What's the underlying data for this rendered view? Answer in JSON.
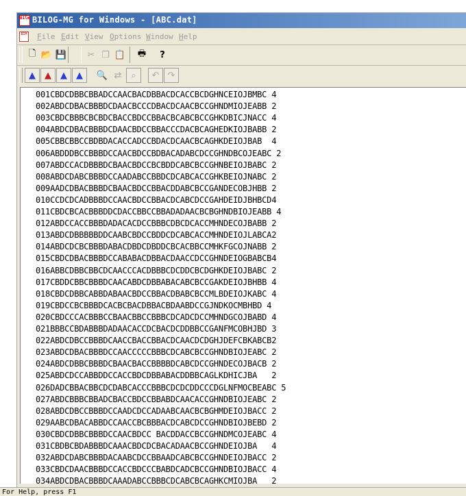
{
  "window": {
    "title": "BILOG-MG for Windows - [ABC.dat]",
    "app_icon_text": "Bilm"
  },
  "menu": [
    {
      "label": "File"
    },
    {
      "label": "Edit"
    },
    {
      "label": "View"
    },
    {
      "label": "Options"
    },
    {
      "label": "Window"
    },
    {
      "label": "Help"
    }
  ],
  "toolbar1": {
    "buttons": [
      {
        "name": "new-file-icon",
        "glyph": "🗋"
      },
      {
        "name": "open-folder-icon",
        "glyph": "📂"
      },
      {
        "name": "save-icon",
        "glyph": "💾"
      },
      {
        "name": "cut-icon",
        "glyph": "✂"
      },
      {
        "name": "copy-icon",
        "glyph": "❐"
      },
      {
        "name": "paste-icon",
        "glyph": "📋"
      },
      {
        "name": "print-icon",
        "glyph": "🖶"
      },
      {
        "name": "help-icon",
        "glyph": "?"
      }
    ]
  },
  "toolbar2": {
    "buttons": [
      {
        "name": "run-phase1-icon",
        "glyph": "▲"
      },
      {
        "name": "run-phase2-icon",
        "glyph": "▲"
      },
      {
        "name": "run-phase3-icon",
        "glyph": "▲"
      },
      {
        "name": "run-all-icon",
        "glyph": "▲"
      },
      {
        "name": "find-icon",
        "glyph": "🔍"
      },
      {
        "name": "find-replace-icon",
        "glyph": "⇄"
      },
      {
        "name": "find-next-icon",
        "glyph": "⌕"
      },
      {
        "name": "undo-icon",
        "glyph": "↶"
      },
      {
        "name": "redo-icon",
        "glyph": "↷"
      }
    ]
  },
  "lines": [
    "001CBDCDBBCBBADCCAACBACDBBACDCACCBCDGHNCEIOJBMBC 4",
    "002ABDCDBACBBBDCDAACBCCCDBACDCAACBCCGHNDMIOJEABB 2",
    "003CBDCBBBCBCBDCBACCBDCCBBACBCABCBCCGHKDBICJNACC 4",
    "004ABDCDBACBBBDCDAACBDCCBBACCCDACBCAGHEDKIOJBABB 2",
    "005CBBCBBCCBDBDACACCADCCBDACDCAACBCAGHKDEIOJBAB  4",
    "006ABDDDBCCBBBDCCAACBDCCBDBACADABCDCCGHNDBCOJEABC 2",
    "007ABDCCACDBBBDCBAACBDCCBCBDDCABCBCCGHNBEIOJBABC 2",
    "008ABDCDABCBBBDCCAADABCCBBDCDCABCACCGHKBEIOJNABC 2",
    "009AADCDBACBBBDCBAACBDCCBBACDDABCBCCGANDECOBJHBB 2",
    "010CCDCDCADBBBDCCAACBDCCBBACDCABCDCCGAHDEIDJBHBCD4",
    "011CBDCBCACBBBDDCDACCBBCCBBADADAACBCBGHNDBIOJEABB 4",
    "012ABDCCACCBBBDADACACDCCBBBCDBCDCACCMHNDECOJBABB 2",
    "013ABDCDBBBBBDDCAABCBDCCBDDCDCABCACCMHNDEIOJLABCA2",
    "014ABDCDCBCBBBDABACDBDCDBDDCBCACBBCCMHKFGCOJNABB 2",
    "015CBDCDBACBBBDCCABABACDBBACDAACCDCCGHNDEIOGBABCB4",
    "016ABBCDBBCBBCDCAACCCACDBBBCDCDDCBCDGHKDEIOJBABC 2",
    "017CBDDCBBCBBBDCAACABDCDBBABACABCBCCGAKDEIOJBHBB 4",
    "018CBDCDBBCABBDABAACBDCCBBACDBABCBCCMLBDEIOJKABC 4",
    "019CBDCCBCBBBDCACBCBACDBBACBDAABDCCGJNDKOCMBHBD 4",
    "020CBDCCCACBBBCCBAACBBCCBBBCDCADCDCCMHNDGCOJBABD 4",
    "021BBBCCBDABBBDADAACACCDCBACDCDDBBCCGANFMCOBHJBD 3",
    "022ABDCDBCCBBBDCAACCBACCBBACDCAACDCDGHJDEFCBKABCB2",
    "023ABDCDBACBBBDCCAACCCCCBBBCDCABCBCCGHNDBIOJEABC 2",
    "024ABDCDBBCBBBDCBAACBACCBBBBDCABCDCCGHNDECOJBACB 2",
    "025ABDCDCCABBDDCCACCBDCDBBABACDDBBCAGLKDHICJBA   2",
    "026DADCBBACBBCDCDABCACCCBBBCDCDCDDCCCDGLNFMOCBEABC 5",
    "027ABDCBBBCBBADCBACCBDCCBBABDCAACACCGHNDBIOJEABC 2",
    "028ABDCDBCCBBBDCCAADCDCCADAABCAACBCBGHMDEIOJBACC 2",
    "029AABCDBACABBDCCAACCBCBBBACDCABCDCCGHNDBIOJBEBD 2",
    "030CBDCDBBCBBBDCCAACBDCC BACDDACCBCCGHNDMCOJEABC 4",
    "031CBDBCBDABBBDCAAACBDCDCBACADAACBCCGHNDEIOJBA   4",
    "032ABDCDABCBBBDACAABCDCCBBAADCABCBCCGHNDEIOJBACC 2",
    "033CBDCDAACBBBDCCACCBDCCCBABDCADCBCCGHNDBIOJBACC 4",
    "034ABDCDBACBBBDCAAADABCCBBBCDCABCBCAGHKCMIOJBA   2"
  ],
  "status": {
    "text": "For Help, press F1"
  }
}
